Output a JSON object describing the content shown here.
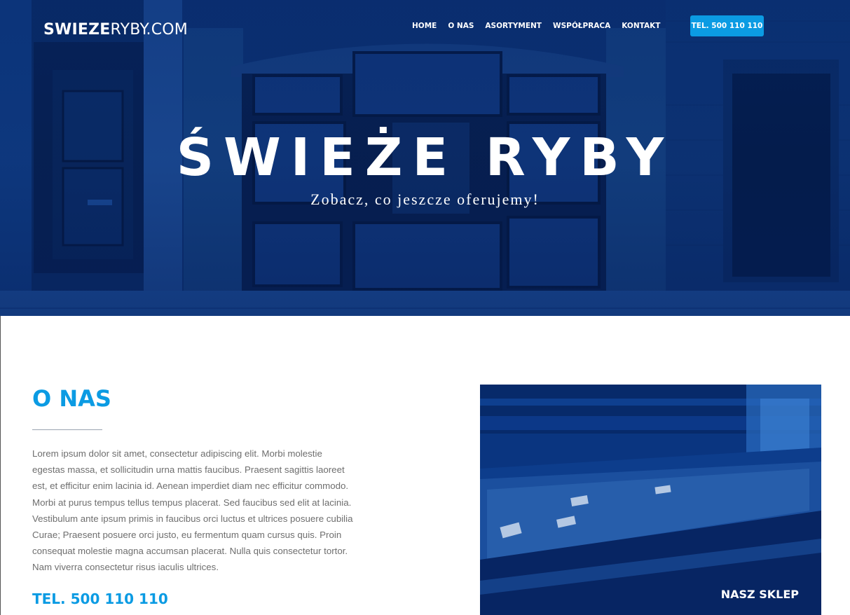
{
  "header": {
    "logo_bold": "SWIEZE",
    "logo_light": "RYBY.COM",
    "nav": [
      {
        "label": "HOME"
      },
      {
        "label": "O NAS"
      },
      {
        "label": "ASORTYMENT"
      },
      {
        "label": "WSPÓŁPRACA"
      },
      {
        "label": "KONTAKT"
      }
    ],
    "phone_button": "TEL. 500 110 110"
  },
  "hero": {
    "title": "ŚWIEŻE RYBY",
    "subtitle": "Zobacz, co jeszcze oferujemy!"
  },
  "about": {
    "title": "O NAS",
    "text": "Lorem ipsum dolor sit amet, consectetur adipiscing elit. Morbi molestie egestas massa, et sollicitudin urna mattis faucibus. Praesent sagittis laoreet est, et efficitur enim lacinia id. Aenean imperdiet diam nec efficitur commodo. Morbi at purus tempus tellus tempus placerat. Sed faucibus sed elit at lacinia. Vestibulum ante ipsum primis in faucibus orci luctus et ultrices posuere cubilia Curae; Praesent posuere orci justo, eu fermentum quam cursus quis. Proin consequat molestie magna accumsan placerat. Nulla quis consectetur tortor. Nam viverra consectetur risus iaculis ultrices.",
    "phone": "TEL. 500 110 110",
    "image_caption": "NASZ SKLEP"
  },
  "colors": {
    "accent": "#0b9be3",
    "hero_tint": "#0a2d6b"
  }
}
